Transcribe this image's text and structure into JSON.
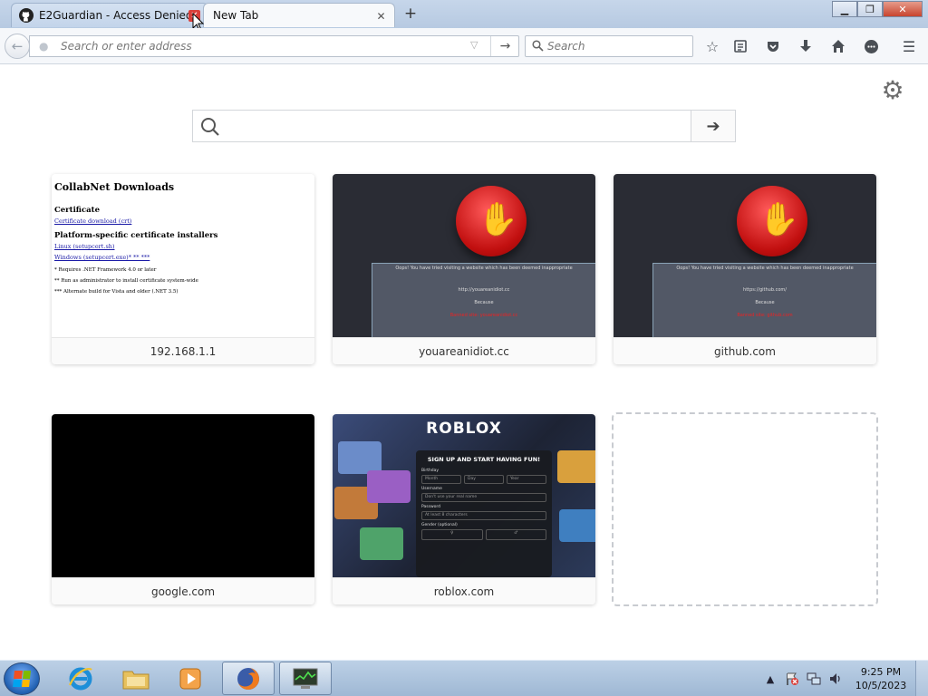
{
  "tabs": [
    {
      "title": "E2Guardian - Access Denied",
      "active": false
    },
    {
      "title": "New Tab",
      "active": true
    }
  ],
  "navbar": {
    "url_placeholder": "Search or enter address",
    "search_placeholder": "Search"
  },
  "newtab": {
    "search_placeholder": ""
  },
  "tiles": [
    {
      "label": "192.168.1.1"
    },
    {
      "label": "youareanidiot.cc"
    },
    {
      "label": "github.com"
    },
    {
      "label": "google.com"
    },
    {
      "label": "roblox.com"
    }
  ],
  "thumb_collabnet": {
    "title": "CollabNet Downloads",
    "h1": "Certificate",
    "l1": "Certificate download (crt)",
    "h2": "Platform-specific certificate installers",
    "l2": "Linux (setupcert.sh)",
    "l3": "Windows (setupcert.exe)* ** ***",
    "s1": "* Requires .NET Framework 4.0 or later",
    "s2": "** Run as administrator to install certificate system-wide",
    "s3": "*** Alternate build for Vista and older (.NET 3.5)"
  },
  "thumb_blocked_1": {
    "line1": "Oops! You have tried visiting a website which has been deemed inappropriate",
    "line2": "http://youareanidiot.cc",
    "line3": "Because",
    "line4": "Banned site: youareanidiot.cc"
  },
  "thumb_blocked_2": {
    "line1": "Oops! You have tried visiting a website which has been deemed inappropriate",
    "line2": "https://github.com/",
    "line3": "Because",
    "line4": "Banned site: github.com"
  },
  "thumb_roblox": {
    "logo": "ROBLOX",
    "title": "SIGN UP AND START HAVING FUN!",
    "birthday": "Birthday",
    "month": "Month",
    "day": "Day",
    "year": "Year",
    "username": "Username",
    "username_ph": "Don't use your real name",
    "password": "Password",
    "password_ph": "At least 8 characters",
    "gender": "Gender (optional)"
  },
  "taskbar": {
    "time": "9:25 PM",
    "date": "10/5/2023"
  },
  "colors": {
    "accent_red": "#d9403b",
    "blocked_bg": "#2a2c34"
  },
  "icons": [
    "github-icon",
    "close-icon",
    "plus-icon",
    "back-arrow-icon",
    "forward-arrow-icon",
    "search-icon",
    "bookmark-star-icon",
    "reading-list-icon",
    "pocket-icon",
    "download-icon",
    "home-icon",
    "chat-icon",
    "menu-icon",
    "gear-icon",
    "windows-logo-icon",
    "ie-icon",
    "folder-icon",
    "media-player-icon",
    "firefox-icon",
    "task-manager-icon",
    "network-icon",
    "volume-icon",
    "flag-icon"
  ]
}
